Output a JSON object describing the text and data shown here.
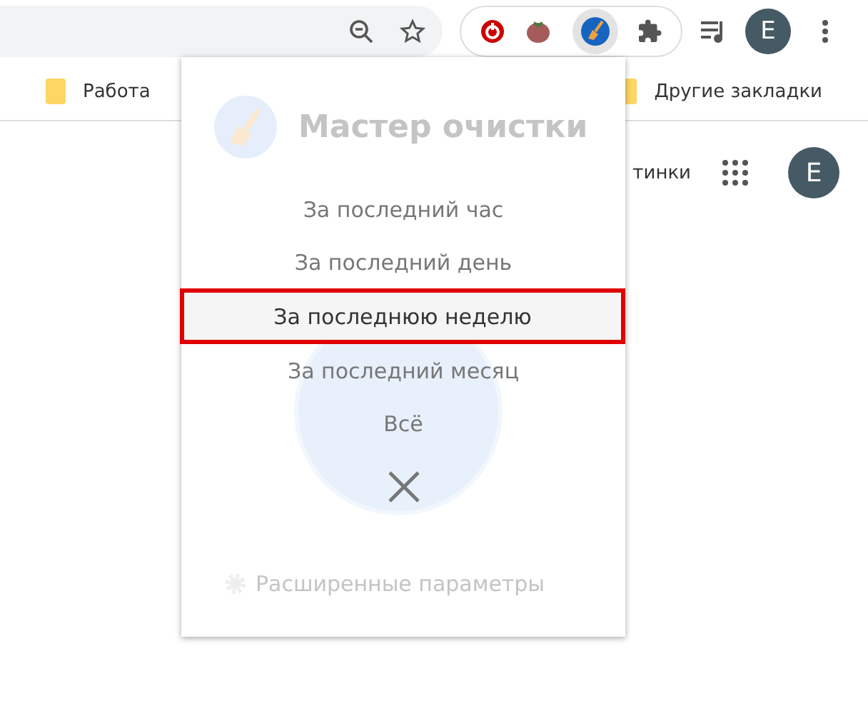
{
  "toolbar": {
    "avatar": "E"
  },
  "bookmarks": [
    {
      "label": "Работа"
    }
  ],
  "other_bookmarks": "Другие закладки",
  "page": {
    "link_fragment": "тинки",
    "avatar": "E"
  },
  "popup": {
    "title": "Мастер очистки",
    "advanced": "Расширенные параметры",
    "menu": [
      {
        "label": "За последний час",
        "selected": false
      },
      {
        "label": "За последний день",
        "selected": false
      },
      {
        "label": "За последнюю неделю",
        "selected": true
      },
      {
        "label": "За последний месяц",
        "selected": false
      },
      {
        "label": "Всё",
        "selected": false
      }
    ]
  }
}
